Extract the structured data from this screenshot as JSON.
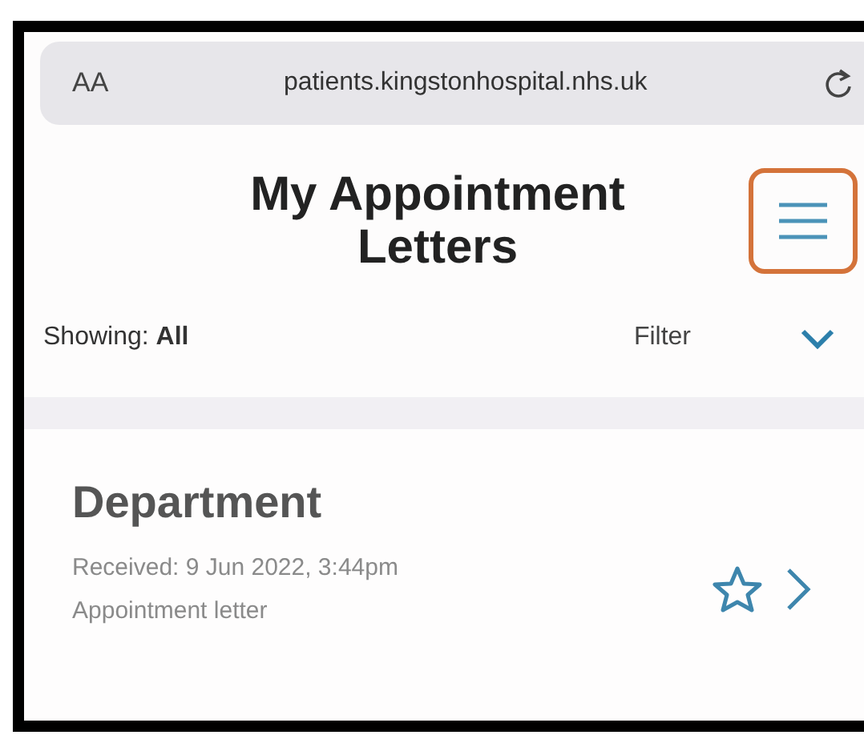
{
  "browser_bar": {
    "text_size_button": "AA",
    "url": "patients.kingstonhospital.nhs.uk"
  },
  "header": {
    "title": "My Appointment Letters",
    "menu_highlighted": true
  },
  "filter_bar": {
    "showing": "Showing: **All**",
    "filter_label": "Filter",
    "expanded": false
  },
  "letters": [
    {
      "department": "Department",
      "received": "Received: 9 Jun 2022, 3:44pm",
      "type": "Appointment letter",
      "starred": false
    }
  ]
}
